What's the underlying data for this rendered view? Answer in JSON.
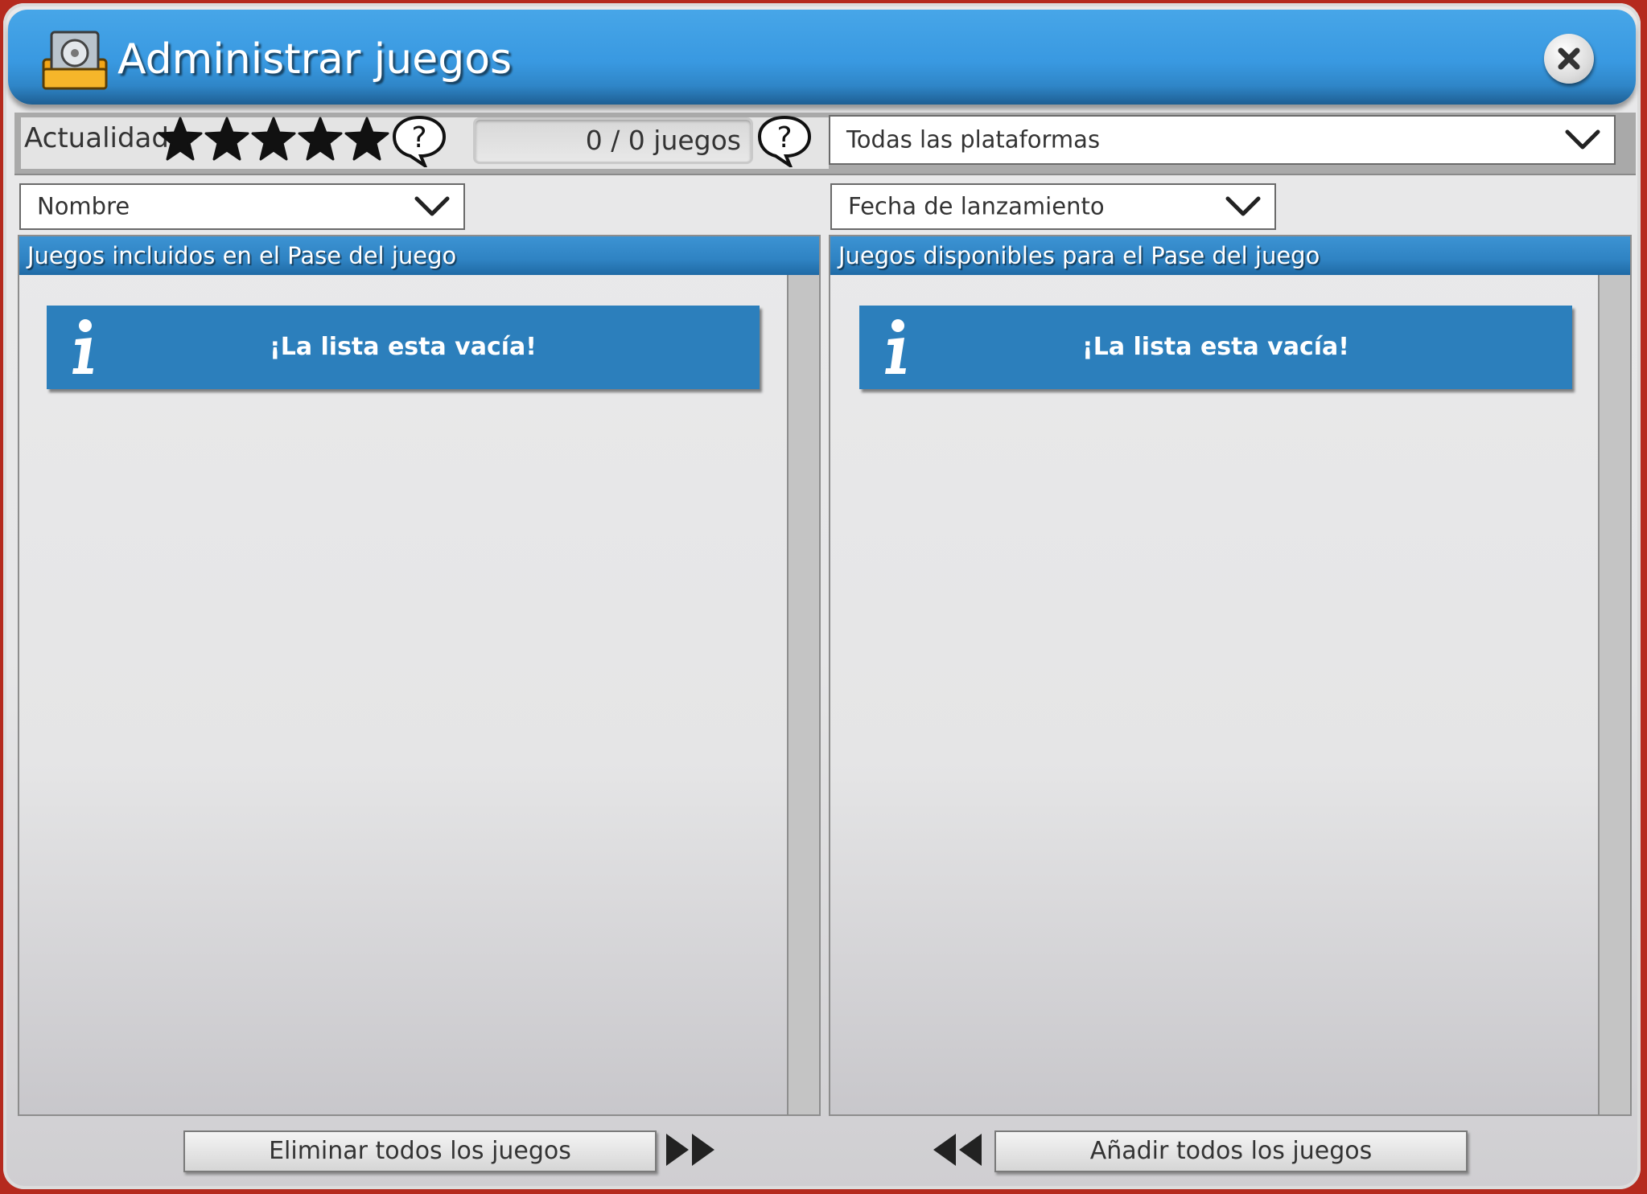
{
  "window": {
    "title": "Administrar juegos",
    "title_icon": "game-box-icon",
    "close_icon": "close-icon"
  },
  "toolbar": {
    "actualidad_label": "Actualidad",
    "rating_stars": 5,
    "rating_max": 5,
    "games_count": "0 / 0 juegos",
    "platform_filter": "Todas las plataformas"
  },
  "left": {
    "sort_value": "Nombre",
    "header": "Juegos incluidos en el Pase del juego",
    "empty_message": "¡La lista esta vacía!",
    "button_label": "Eliminar todos los juegos"
  },
  "right": {
    "sort_value": "Fecha de lanzamiento",
    "header": "Juegos disponibles para el Pase del juego",
    "empty_message": "¡La lista esta vacía!",
    "button_label": "Añadir todos los juegos"
  },
  "colors": {
    "title_blue": "#3999e1",
    "header_blue": "#2f83c3",
    "info_blue": "#2c7fbc"
  }
}
